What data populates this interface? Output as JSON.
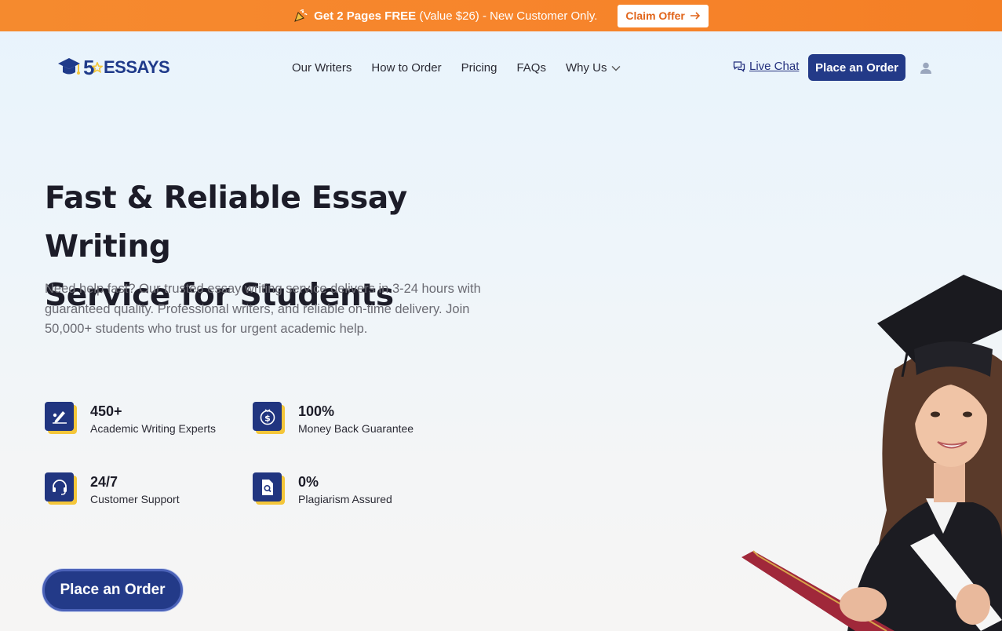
{
  "promo": {
    "bold": "Get 2 Pages FREE",
    "rest": " (Value $26) - New Customer Only.",
    "claim_label": "Claim Offer"
  },
  "header": {
    "logo_digit": "5",
    "logo_text": "ESSAYS",
    "nav": [
      "Our Writers",
      "How to Order",
      "Pricing",
      "FAQs",
      "Why Us"
    ],
    "live_chat": "Live Chat",
    "order_button": "Place an Order"
  },
  "hero": {
    "title_line1": "Fast & Reliable Essay Writing",
    "title_line2": "Service for Students",
    "description": "Need help fast? Our trusted essay writing service delivers in 3-24 hours with guaranteed quality. Professional writers, and reliable on-time delivery. Join 50,000+ students who trust us for urgent academic help.",
    "stats": [
      {
        "value": "450+",
        "label": "Academic Writing Experts",
        "icon": "writer-icon"
      },
      {
        "value": "100%",
        "label": "Money Back Guarantee",
        "icon": "money-back-icon"
      },
      {
        "value": "24/7",
        "label": "Customer Support",
        "icon": "headset-icon"
      },
      {
        "value": "0%",
        "label": "Plagiarism Assured",
        "icon": "document-search-icon"
      }
    ],
    "order_button": "Place an Order"
  },
  "colors": {
    "brand": "#233a88",
    "accent": "#f58a2e",
    "stat_shadow": "#f4c63a"
  }
}
